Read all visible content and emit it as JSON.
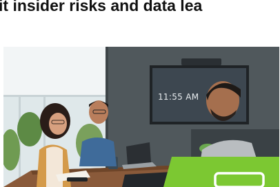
{
  "article": {
    "headline": "it insider risks and data lea"
  },
  "hero_photo": {
    "screen_time": "11:55 AM",
    "colors": {
      "wall": "#50585c",
      "window": "#dfe8ea",
      "table": "#8a5a3a",
      "tv_frame": "#1f2326",
      "tv_screen": "#3d4750",
      "accent_green": "#7cc832"
    }
  },
  "promo_badge": {
    "color": "#7cc832"
  }
}
